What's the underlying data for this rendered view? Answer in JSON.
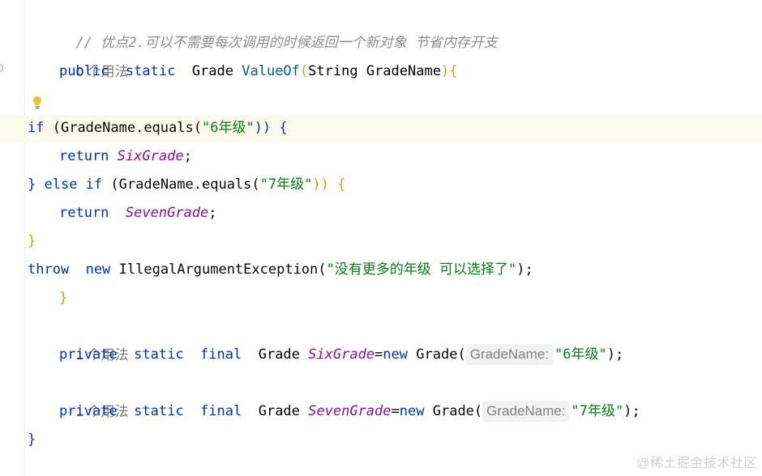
{
  "editor": {
    "comment": "// 优点2.可以不需要每次调用的时候返回一个新对象 节省内存开支",
    "usage_top": "0 个用法",
    "method": {
      "modifier1": "public",
      "modifier2": "static",
      "return_type": "Grade",
      "name": "ValueOf",
      "param_type": "String",
      "param_name": "GradeName",
      "open": "{"
    },
    "if_line": {
      "kw": "if",
      "expr": "(GradeName.equals(",
      "str": "\"6年级\"",
      "close": ")) {"
    },
    "return1": {
      "kw": "return",
      "field": "SixGrade",
      "semi": ";"
    },
    "else_if_line": {
      "close_brace": "}",
      "kw": "else if",
      "expr": "(GradeName.equals(",
      "str": "\"7年级\"",
      "close": ")) {"
    },
    "return2": {
      "kw": "return",
      "field": "SevenGrade",
      "semi": ";"
    },
    "close_if": "}",
    "throw_line": {
      "kw1": "throw",
      "kw2": "new",
      "cls": "IllegalArgumentException(",
      "str": "\"没有更多的年级 可以选择了\"",
      "end": ");"
    },
    "close_method": "}",
    "usage_six": "1 个用法",
    "field_six": {
      "mod1": "private",
      "mod2": "static",
      "mod3": "final",
      "type": "Grade",
      "name": "SixGrade",
      "eq": "=",
      "new_kw": "new",
      "ctor": "Grade(",
      "hint": "GradeName:",
      "str": "\"6年级\"",
      "end": ");"
    },
    "usage_seven": "1 个用法",
    "field_seven": {
      "mod1": "private",
      "mod2": "static",
      "mod3": "final",
      "type": "Grade",
      "name": "SevenGrade",
      "eq": "=",
      "new_kw": "new",
      "ctor": "Grade(",
      "hint": "GradeName:",
      "str": "\"7年级\"",
      "end": ");"
    },
    "close_class": "}"
  },
  "watermark": "@稀土掘金技术社区",
  "icons": {
    "intention": "lightbulb-icon",
    "gutter": "gutter-mark-icon"
  },
  "colors": {
    "keyword": "#0033b3",
    "string": "#067d17",
    "field": "#871094",
    "function": "#00627a",
    "comment": "#8c8c8c",
    "current_line": "#fcfaed"
  }
}
